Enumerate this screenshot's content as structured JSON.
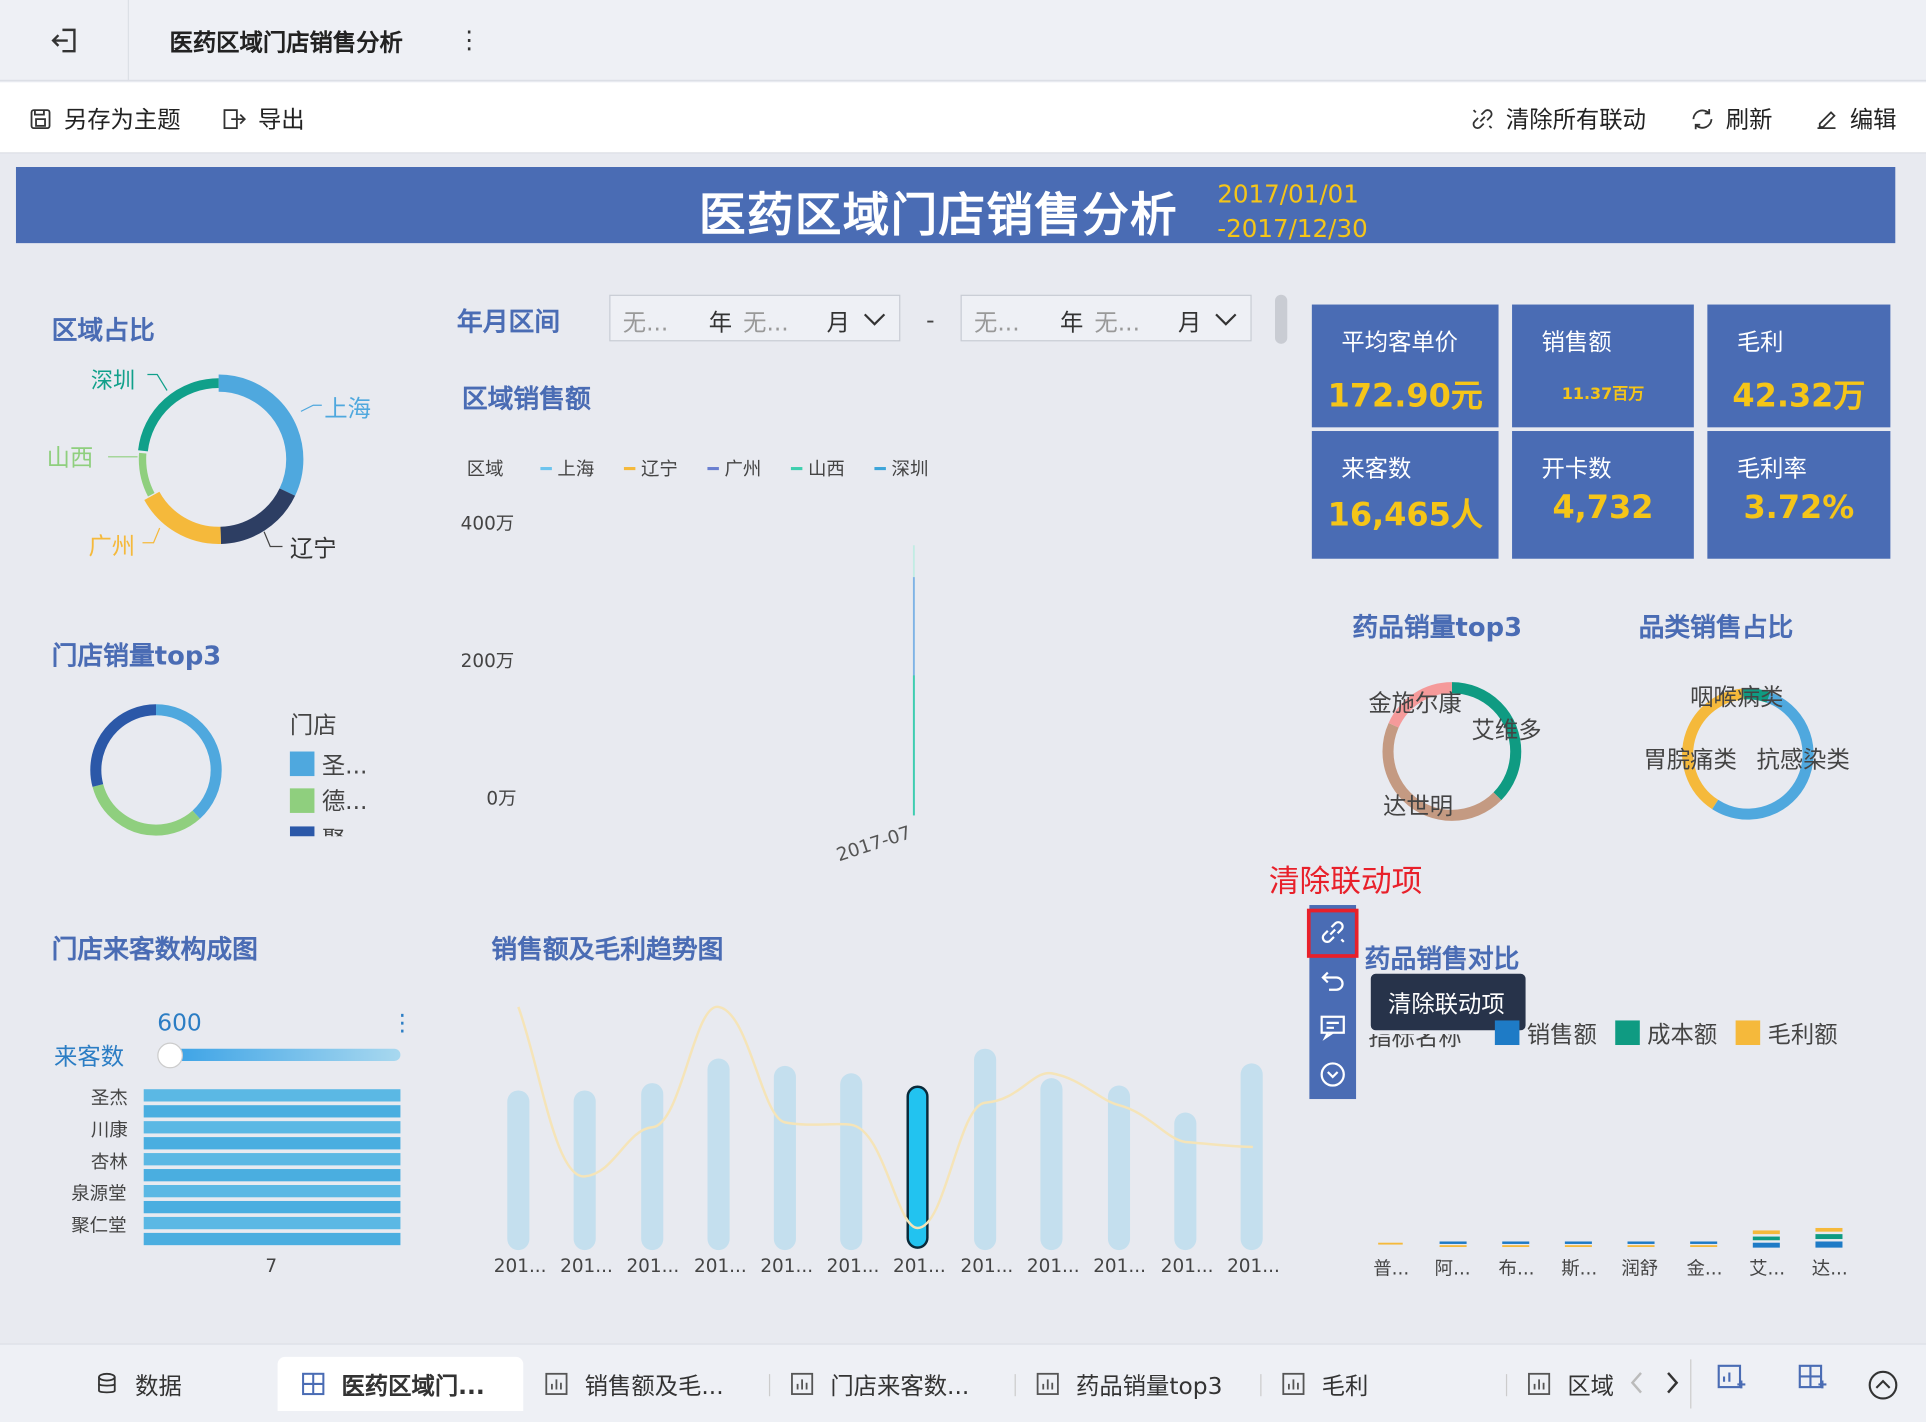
{
  "topbar": {
    "title": "医药区域门店销售分析",
    "more": "⋮"
  },
  "toolbar": {
    "save_theme": "另存为主题",
    "export": "导出",
    "clear_all": "清除所有联动",
    "refresh": "刷新",
    "edit": "编辑"
  },
  "banner": {
    "title": "医药区域门店销售分析",
    "date_from": "2017/01/01",
    "date_to": "-2017/12/30"
  },
  "filter": {
    "label": "年月区间",
    "start": {
      "year_ph": "无...",
      "year_unit": "年",
      "month_ph": "无...",
      "month_unit": "月"
    },
    "dash": "-",
    "end": {
      "year_ph": "无...",
      "year_unit": "年",
      "month_ph": "无...",
      "month_unit": "月"
    }
  },
  "region_share": {
    "title": "区域占比",
    "labels": [
      "上海",
      "辽宁",
      "广州",
      "山西",
      "深圳"
    ],
    "colors": {
      "上海": "#4fa8de",
      "辽宁": "#2d3e63",
      "广州": "#f5b93b",
      "山西": "#8fcf7e",
      "深圳": "#10a08a"
    }
  },
  "region_sales": {
    "title": "区域销售额",
    "legend_title": "区域",
    "legend": [
      "上海",
      "辽宁",
      "广州",
      "山西",
      "深圳"
    ],
    "y_ticks": [
      "400万",
      "200万",
      "0万"
    ],
    "x_tick": "2017-07"
  },
  "kpis": [
    {
      "label": "平均客单价",
      "value": "172.90元"
    },
    {
      "label": "销售额",
      "value": "11.37百万"
    },
    {
      "label": "毛利",
      "value": "42.32万"
    },
    {
      "label": "来客数",
      "value": "16,465人"
    },
    {
      "label": "开卡数",
      "value": "4,732"
    },
    {
      "label": "毛利率",
      "value": "3.72%"
    }
  ],
  "store_top3": {
    "title": "门店销量top3",
    "legend_title": "门店",
    "items": [
      "圣...",
      "德...",
      "聚"
    ]
  },
  "drug_top3": {
    "title": "药品销量top3",
    "labels": [
      "金施尔康",
      "艾维多",
      "达世明"
    ]
  },
  "category_share": {
    "title": "品类销售占比",
    "labels": [
      "咽喉病类",
      "胃脘痛类",
      "抗感染类"
    ]
  },
  "link_hint": {
    "label": "清除联动项",
    "tooltip": "清除联动项"
  },
  "visitor_chart": {
    "title": "门店来客数构成图",
    "metric": "来客数",
    "slider_value": "600",
    "stores": [
      "圣杰",
      "川康",
      "杏林",
      "泉源堂",
      "聚仁堂"
    ],
    "x_tick": "7",
    "more": "⋮"
  },
  "trend_chart": {
    "title": "销售额及毛利趋势图",
    "x_labels": [
      "201...",
      "201...",
      "201...",
      "201...",
      "201...",
      "201...",
      "201...",
      "201...",
      "201...",
      "201...",
      "201...",
      "201..."
    ]
  },
  "drug_compare": {
    "title": "药品销售对比",
    "legend_prefix": "指标名称",
    "legend": [
      {
        "label": "销售额",
        "color": "#1e7bc6"
      },
      {
        "label": "成本额",
        "color": "#0f9b82"
      },
      {
        "label": "毛利额",
        "color": "#f5b93b"
      }
    ],
    "x_labels": [
      "普...",
      "阿...",
      "布...",
      "斯...",
      "润舒",
      "金...",
      "艾...",
      "达..."
    ]
  },
  "tabs": {
    "data": "数据",
    "items": [
      "医药区域门...",
      "销售额及毛...",
      "门店来客数...",
      "药品销量top3",
      "毛利",
      "区域"
    ]
  }
}
